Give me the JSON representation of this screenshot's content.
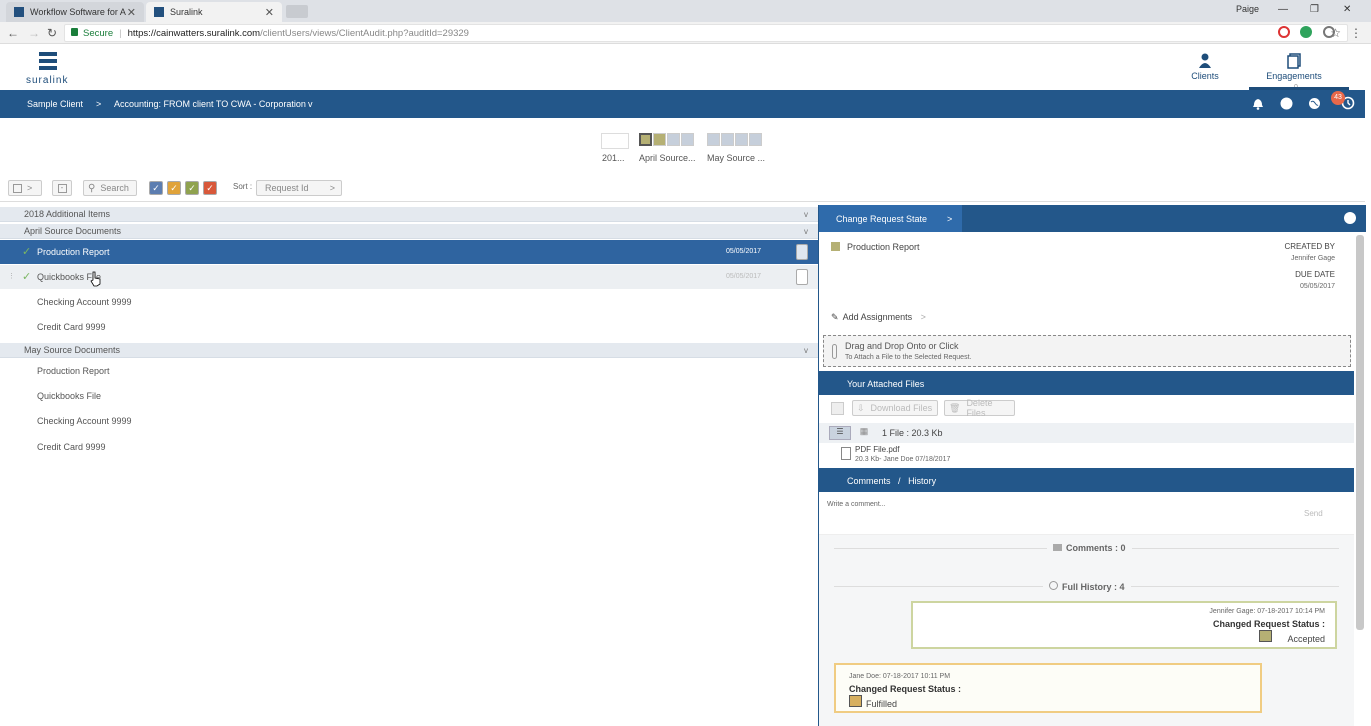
{
  "browser": {
    "tabs": [
      {
        "title": "Workflow Software for A"
      },
      {
        "title": "Suralink"
      }
    ],
    "profile": "Paige",
    "secure_label": "Secure",
    "url_host": "https://cainwatters.suralink.com",
    "url_path": "/clientUsers/views/ClientAudit.php?auditId=29329"
  },
  "app": {
    "brand": "suralink",
    "nav": [
      {
        "label": "Clients",
        "icon": "clients-icon"
      },
      {
        "label": "Engagements",
        "icon": "engagements-icon",
        "count": "0"
      }
    ],
    "breadcrumb": {
      "client": "Sample Client",
      "separator": ">",
      "engagement": "Accounting: FROM client TO CWA - Corporation",
      "chevron": "v"
    },
    "notification_count": "43"
  },
  "months": [
    {
      "label": "201..."
    },
    {
      "label": "April Source..."
    },
    {
      "label": "May Source ..."
    }
  ],
  "toolbar": {
    "search": "Search",
    "sort_label": "Sort :",
    "sort_value": "Request Id",
    "status_colors": [
      "#5c7db0",
      "#e0a33a",
      "#8fa24f",
      "#d8583a"
    ]
  },
  "groups": [
    {
      "label": "2018 Additional Items",
      "chevron": "v"
    },
    {
      "label": "April Source Documents",
      "chevron": "v",
      "items": [
        {
          "label": "Production Report",
          "date": "05/05/2017"
        },
        {
          "label": "Quickbooks File",
          "date": "05/05/2017"
        },
        {
          "label": "Checking Account 9999"
        },
        {
          "label": "Credit Card 9999"
        }
      ]
    },
    {
      "label": "May Source Documents",
      "chevron": "v",
      "items": [
        {
          "label": "Production Report"
        },
        {
          "label": "Quickbooks File"
        },
        {
          "label": "Checking Account 9999"
        },
        {
          "label": "Credit Card 9999"
        }
      ]
    }
  ],
  "detail": {
    "tab": "Change Request State",
    "tab_arrow": ">",
    "title": "Production Report",
    "created_by_label": "CREATED BY",
    "created_by": "Jennifer Gage",
    "due_date_label": "DUE DATE",
    "due_date": "05/05/2017",
    "add_assignments": "Add Assignments",
    "drop_title": "Drag and Drop Onto or Click",
    "drop_sub": "To Attach a File to the Selected Request.",
    "files_header": "Your Attached Files",
    "download": "Download Files",
    "delete": "Delete Files",
    "file_count": "1 File : 20.3 Kb",
    "file_name": "PDF File.pdf",
    "file_meta": "20.3 Kb- Jane Doe 07/18/2017",
    "comments_header": "Comments",
    "history_header": "History",
    "comment_placeholder": "Write a comment...",
    "send": "Send",
    "comments_count": "Comments : 0",
    "history_count": "Full History : 4",
    "history": [
      {
        "meta": "Jennifer Gage: 07-18-2017 10:14 PM",
        "title": "Changed Request Status :",
        "status": "Accepted",
        "color": "#b5b074"
      },
      {
        "meta": "Jane Doe: 07-18-2017 10:11 PM",
        "title": "Changed Request Status :",
        "status": "Fulfilled",
        "color": "#d7b060"
      }
    ]
  }
}
